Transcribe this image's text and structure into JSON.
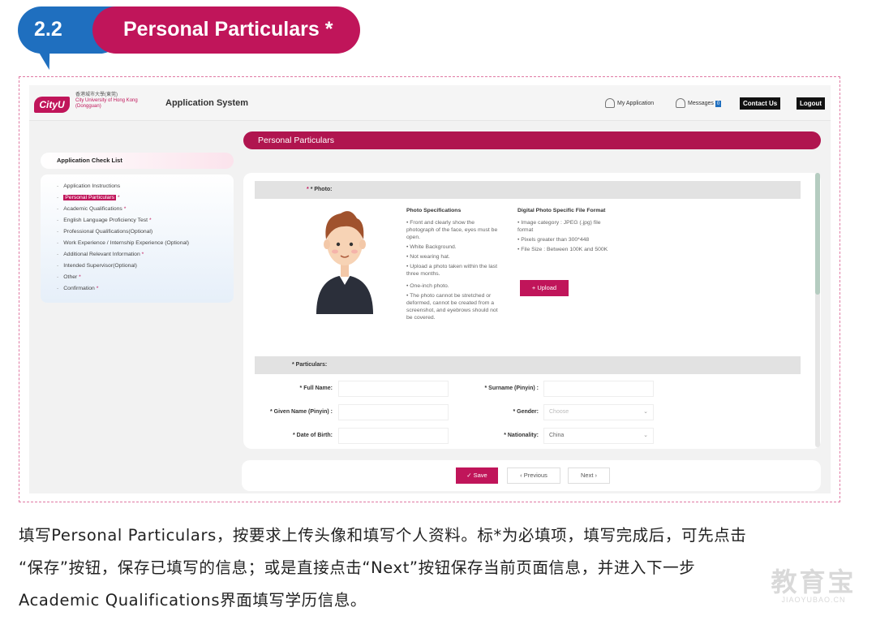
{
  "banner": {
    "number": "2.2",
    "title": "Personal Particulars *"
  },
  "topbar": {
    "logo_text": "CityU",
    "logo_cn": "香港城市大學(東莞)",
    "logo_en": "City University of Hong Kong",
    "logo_en2": "(Dongguan)",
    "app_title": "Application System",
    "my_application": "My Application",
    "messages": "Messages",
    "messages_count": "0",
    "contact_us": "Contact Us",
    "logout": "Logout"
  },
  "checklist": {
    "title": "Application Check List",
    "items": [
      {
        "label": "Application Instructions",
        "required": "",
        "active": false
      },
      {
        "label": "Personal Particulars",
        "required": "*",
        "active": true
      },
      {
        "label": "Academic Qualifications",
        "required": "*",
        "active": false
      },
      {
        "label": "English Language Proficiency Test",
        "required": "*",
        "active": false
      },
      {
        "label": "Professional Qualifications(Optional)",
        "required": "",
        "active": false
      },
      {
        "label": "Work Experience / Internship Experience (Optional)",
        "required": "",
        "active": false
      },
      {
        "label": "Additional Relevant Information",
        "required": "*",
        "active": false
      },
      {
        "label": "Intended Supervisor(Optional)",
        "required": "",
        "active": false
      },
      {
        "label": "Other",
        "required": "*",
        "active": false
      },
      {
        "label": "Confirmation",
        "required": "*",
        "active": false
      }
    ]
  },
  "main": {
    "title": "Personal Particulars",
    "photo_label": "* Photo:",
    "photo_spec_title": "Photo Specifications",
    "photo_specs": [
      "• Front and clearly show the photograph of the face, eyes must be open.",
      "• White Background.",
      "• Not wearing hat.",
      "• Upload a photo taken within the last three months.",
      "• One-inch photo.",
      "• The photo cannot be stretched or deformed, cannot be created from a screenshot, and eyebrows should not be covered."
    ],
    "digital_spec_title": "Digital Photo Specific File Format",
    "digital_specs": [
      "• Image category : JPEG (.jpg) file format",
      "• Pixels greater than 300*448",
      "• File Size : Between 100K and 500K"
    ],
    "upload_label": "+ Upload",
    "particulars_label": "* Particulars:",
    "fields": {
      "full_name": "* Full Name:",
      "surname": "* Surname (Pinyin) :",
      "given_name": "* Given Name (Pinyin) :",
      "gender": "* Gender:",
      "gender_placeholder": "Choose",
      "dob": "* Date of Birth:",
      "nationality": "* Nationality:",
      "nationality_value": "China"
    }
  },
  "bottom": {
    "save": "Save",
    "previous": "Previous",
    "next": "Next"
  },
  "caption": {
    "line1": "填写Personal Particulars，按要求上传头像和填写个人资料。标*为必填项，填写完成后，可先点击",
    "line2": "“保存”按钮，保存已填写的信息；或是直接点击“Next”按钮保存当前页面信息，并进入下一步",
    "line3": "Academic Qualifications界面填写学历信息。"
  },
  "watermark": {
    "cn": "教育宝",
    "en": "JIAOYUBAO.CN"
  },
  "colors": {
    "brand": "#c0155a",
    "blue": "#1f6fbf"
  }
}
